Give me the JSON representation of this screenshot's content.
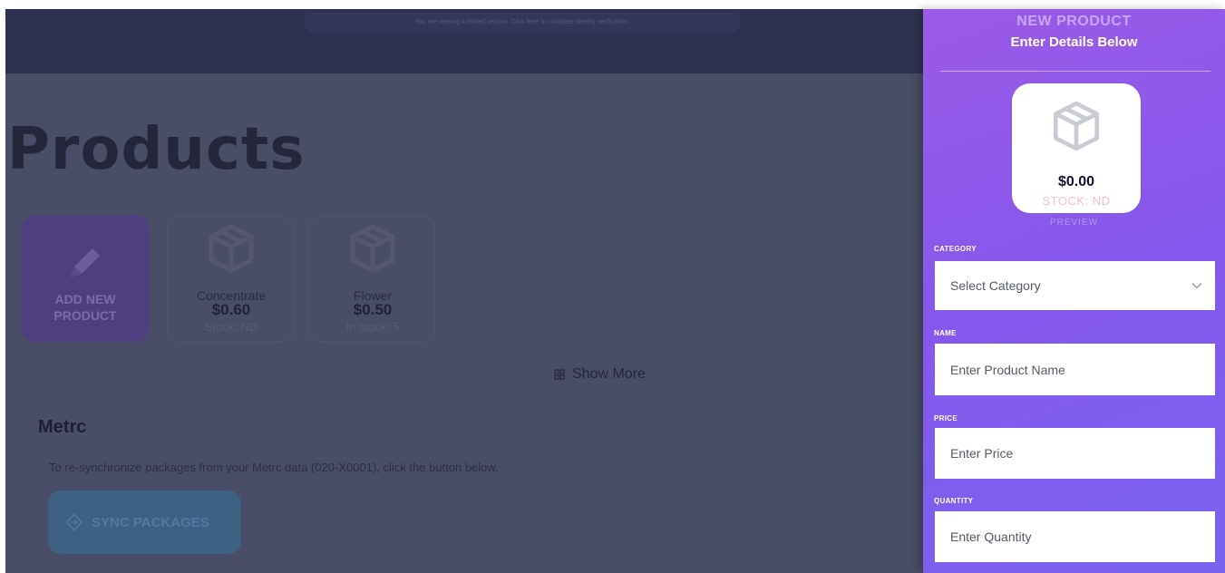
{
  "banner": {
    "text": "You are viewing a limited version. Click here to complete identity verification."
  },
  "page": {
    "title": "Products"
  },
  "add_tile": {
    "label_line1": "ADD NEW",
    "label_line2": "PRODUCT"
  },
  "products": [
    {
      "name": "Concentrate",
      "price": "$0.60",
      "stock": "Stock: ND"
    },
    {
      "name": "Flower",
      "price": "$0.50",
      "stock": "In stock: 5"
    }
  ],
  "show_more": {
    "label": "Show More"
  },
  "metrc": {
    "title": "Metrc",
    "description": "To re-synchronize packages from your Metrc data (020-X0001), click the button below.",
    "sync_label": "SYNC PACKAGES"
  },
  "panel": {
    "heading": "NEW PRODUCT",
    "subheading": "Enter Details Below",
    "preview": {
      "price": "$0.00",
      "stock": "STOCK: ND",
      "label": "PREVIEW"
    },
    "category": {
      "label": "CATEGORY",
      "value": "Select Category"
    },
    "name": {
      "label": "NAME",
      "placeholder": "Enter Product Name"
    },
    "price": {
      "label": "PRICE",
      "placeholder": "Enter Price"
    },
    "quantity": {
      "label": "QUANTITY",
      "placeholder": "Enter Quantity"
    }
  },
  "colors": {
    "panel_accent": "#8a5ae9",
    "page_overlay": "#4a4d66",
    "stock_pink": "#f5c2cf"
  }
}
